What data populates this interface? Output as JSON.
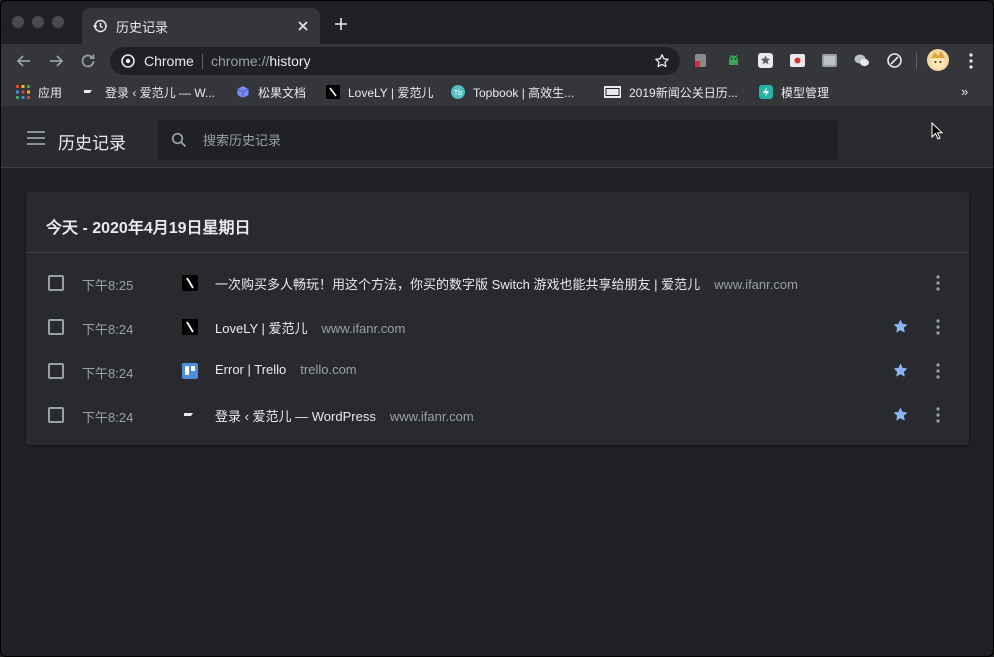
{
  "window": {
    "tab": {
      "title": "历史记录",
      "icon": "history-icon"
    }
  },
  "toolbar": {
    "omnibox": {
      "chip_label": "Chrome",
      "url_scheme": "chrome://",
      "url_host": "history",
      "site_icon": "chrome-logo-icon"
    },
    "extensions": [
      "red-extension-icon",
      "android-extension-icon",
      "star-extension-icon",
      "red-dot-extension-icon",
      "image-extension-icon",
      "wechat-extension-icon",
      "shield-extension-icon"
    ]
  },
  "bookmarks": {
    "items": [
      {
        "label": "应用",
        "icon": "apps-grid-icon"
      },
      {
        "label": "登录 ‹ 爱范儿 — W...",
        "icon": "ifanr-icon"
      },
      {
        "label": "松果文档",
        "icon": "cube-icon"
      },
      {
        "label": "LoveLY | 爱范儿",
        "icon": "ifanr-icon"
      },
      {
        "label": "Topbook | 高效生...",
        "icon": "topbook-icon"
      },
      {
        "label": "2019新闻公关日历...",
        "icon": "prn-icon"
      },
      {
        "label": "模型管理",
        "icon": "lightning-icon"
      }
    ],
    "more": "»"
  },
  "page": {
    "title": "历史记录",
    "search_placeholder": "搜索历史记录"
  },
  "history": {
    "date_header": "今天 - 2020年4月19日星期日",
    "entries": [
      {
        "time": "下午8:25",
        "title": "一次购买多人畅玩！用这个方法，你买的数字版 Switch 游戏也能共享给朋友 | 爱范儿",
        "domain": "www.ifanr.com",
        "favicon": "ifanr-icon",
        "starred": false
      },
      {
        "time": "下午8:24",
        "title": "LoveLY | 爱范儿",
        "domain": "www.ifanr.com",
        "favicon": "ifanr-icon",
        "starred": true
      },
      {
        "time": "下午8:24",
        "title": "Error | Trello",
        "domain": "trello.com",
        "favicon": "trello-icon",
        "starred": true
      },
      {
        "time": "下午8:24",
        "title": "登录 ‹ 爱范儿 — WordPress",
        "domain": "www.ifanr.com",
        "favicon": "ifanr-icon",
        "starred": true
      }
    ]
  },
  "colors": {
    "background": "#202124",
    "surface": "#292a2d",
    "toolbar": "#35363a",
    "text": "#e8eaed",
    "secondary_text": "#9aa0a6",
    "star": "#8ab4f8"
  }
}
